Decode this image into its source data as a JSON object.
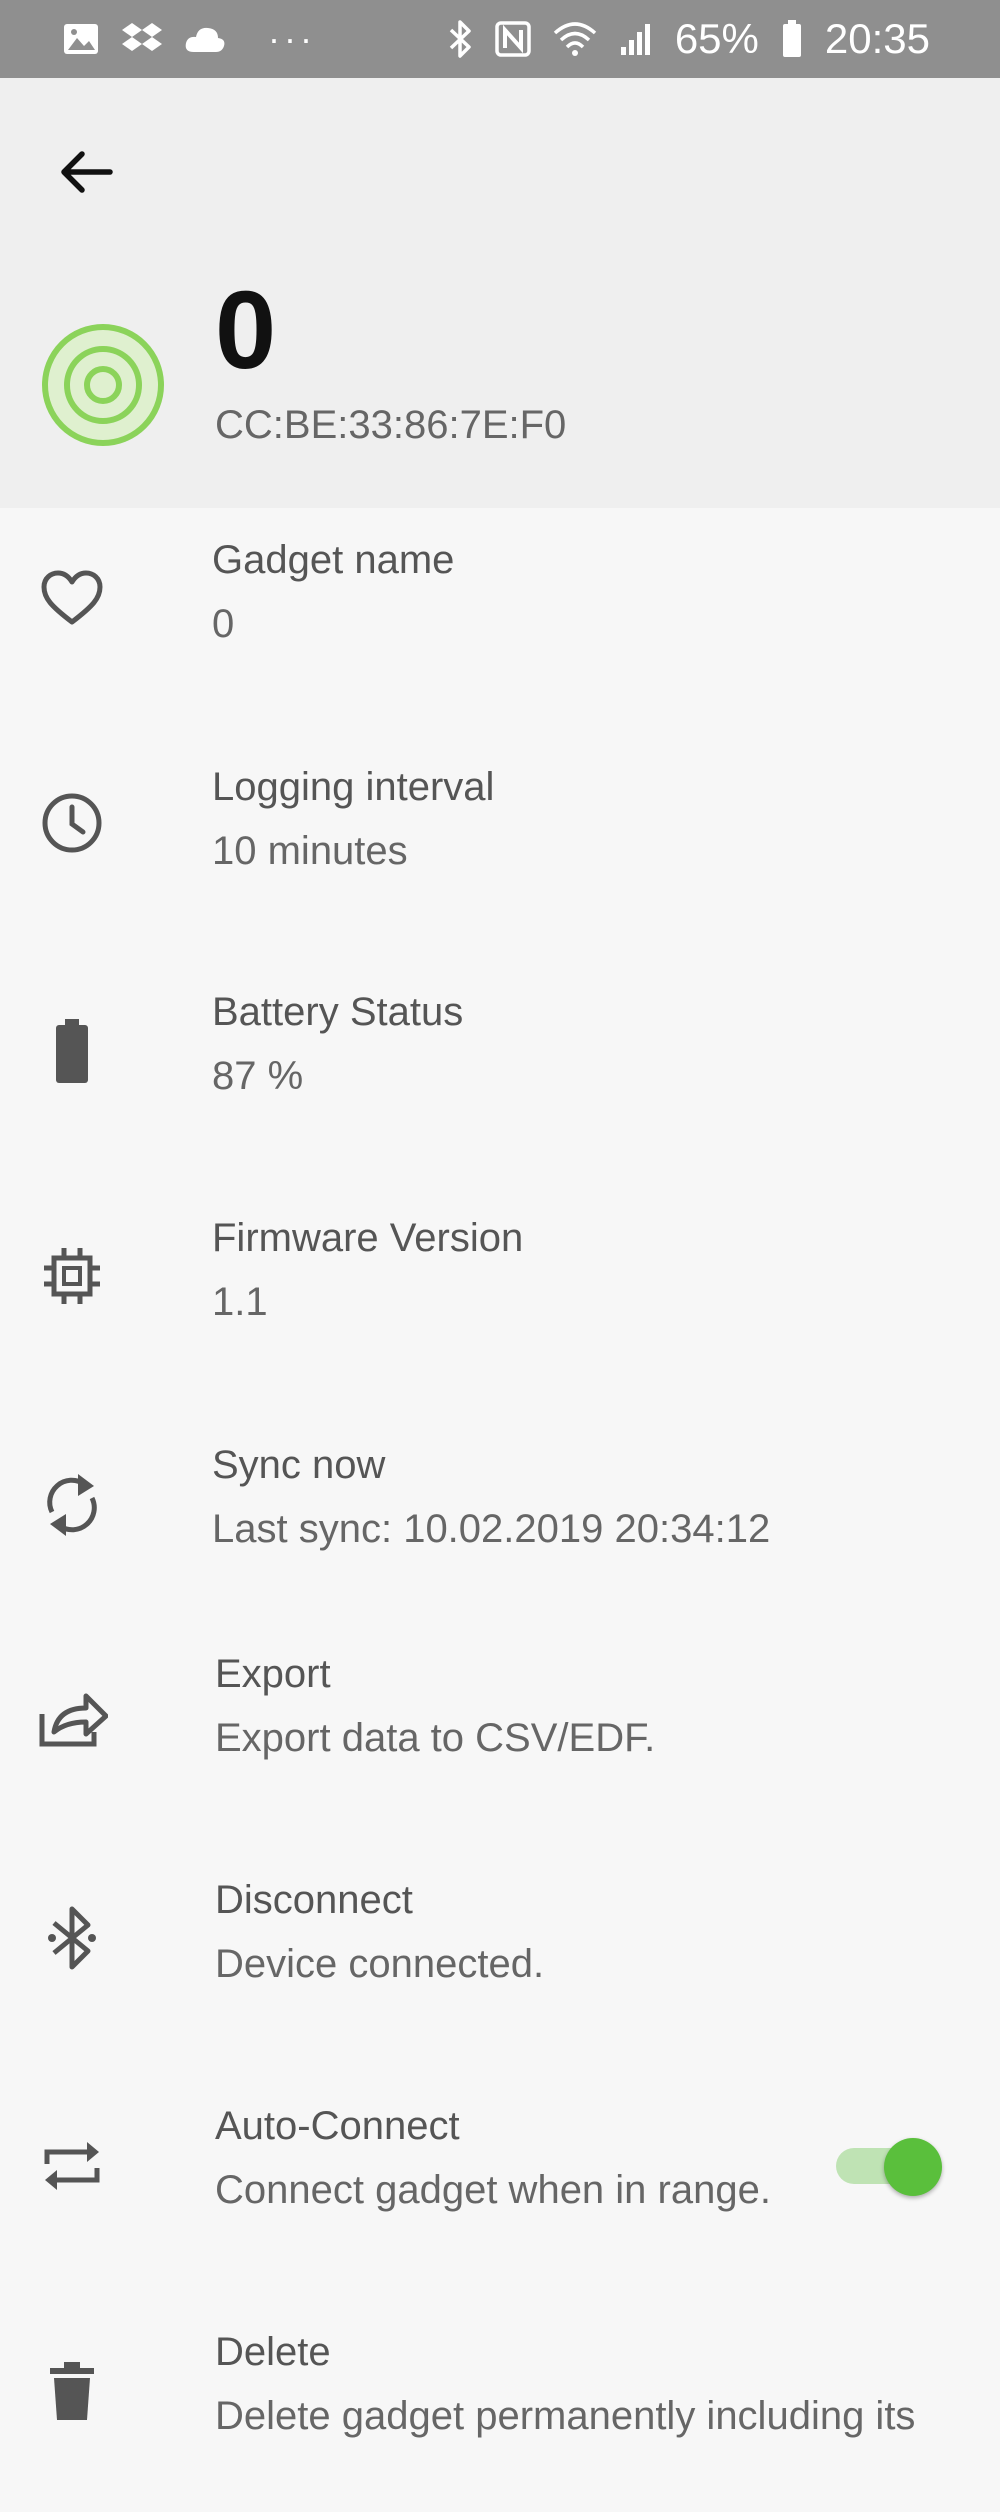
{
  "status_bar": {
    "battery_percent": "65%",
    "time": "20:35",
    "more": "···"
  },
  "toolbar": {
    "back_icon": "arrow-back-icon"
  },
  "header": {
    "gadget_title": "0",
    "mac_address": "CC:BE:33:86:7E:F0",
    "accent_color": "#8bd35a"
  },
  "settings": {
    "gadget_name": {
      "title": "Gadget name",
      "value": "0"
    },
    "logging_interval": {
      "title": "Logging interval",
      "value": "10 minutes"
    },
    "battery_status": {
      "title": "Battery Status",
      "value": "87 %"
    },
    "firmware_version": {
      "title": "Firmware Version",
      "value": "1.1"
    },
    "sync_now": {
      "title": "Sync now",
      "value": "Last sync: 10.02.2019 20:34:12"
    },
    "export": {
      "title": "Export",
      "value": "Export data to CSV/EDF."
    },
    "disconnect": {
      "title": "Disconnect",
      "value": "Device connected."
    },
    "auto_connect": {
      "title": "Auto-Connect",
      "value": "Connect gadget when in range.",
      "enabled": true
    },
    "delete": {
      "title": "Delete",
      "value": "Delete gadget permanently including its"
    }
  },
  "colors": {
    "toggle_on": "#5abf3c",
    "status_bar_bg": "#8f8f8f",
    "header_bg": "#efefef"
  }
}
